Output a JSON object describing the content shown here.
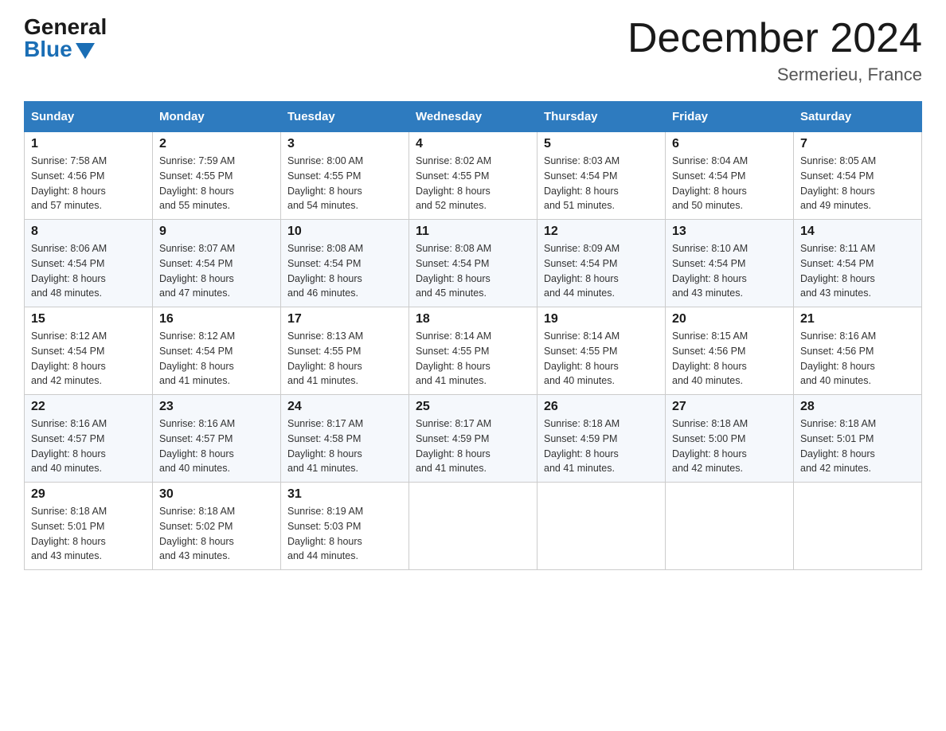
{
  "header": {
    "logo_general": "General",
    "logo_blue": "Blue",
    "month_title": "December 2024",
    "location": "Sermerieu, France"
  },
  "weekdays": [
    "Sunday",
    "Monday",
    "Tuesday",
    "Wednesday",
    "Thursday",
    "Friday",
    "Saturday"
  ],
  "weeks": [
    [
      {
        "day": "1",
        "sunrise": "7:58 AM",
        "sunset": "4:56 PM",
        "daylight": "8 hours and 57 minutes."
      },
      {
        "day": "2",
        "sunrise": "7:59 AM",
        "sunset": "4:55 PM",
        "daylight": "8 hours and 55 minutes."
      },
      {
        "day": "3",
        "sunrise": "8:00 AM",
        "sunset": "4:55 PM",
        "daylight": "8 hours and 54 minutes."
      },
      {
        "day": "4",
        "sunrise": "8:02 AM",
        "sunset": "4:55 PM",
        "daylight": "8 hours and 52 minutes."
      },
      {
        "day": "5",
        "sunrise": "8:03 AM",
        "sunset": "4:54 PM",
        "daylight": "8 hours and 51 minutes."
      },
      {
        "day": "6",
        "sunrise": "8:04 AM",
        "sunset": "4:54 PM",
        "daylight": "8 hours and 50 minutes."
      },
      {
        "day": "7",
        "sunrise": "8:05 AM",
        "sunset": "4:54 PM",
        "daylight": "8 hours and 49 minutes."
      }
    ],
    [
      {
        "day": "8",
        "sunrise": "8:06 AM",
        "sunset": "4:54 PM",
        "daylight": "8 hours and 48 minutes."
      },
      {
        "day": "9",
        "sunrise": "8:07 AM",
        "sunset": "4:54 PM",
        "daylight": "8 hours and 47 minutes."
      },
      {
        "day": "10",
        "sunrise": "8:08 AM",
        "sunset": "4:54 PM",
        "daylight": "8 hours and 46 minutes."
      },
      {
        "day": "11",
        "sunrise": "8:08 AM",
        "sunset": "4:54 PM",
        "daylight": "8 hours and 45 minutes."
      },
      {
        "day": "12",
        "sunrise": "8:09 AM",
        "sunset": "4:54 PM",
        "daylight": "8 hours and 44 minutes."
      },
      {
        "day": "13",
        "sunrise": "8:10 AM",
        "sunset": "4:54 PM",
        "daylight": "8 hours and 43 minutes."
      },
      {
        "day": "14",
        "sunrise": "8:11 AM",
        "sunset": "4:54 PM",
        "daylight": "8 hours and 43 minutes."
      }
    ],
    [
      {
        "day": "15",
        "sunrise": "8:12 AM",
        "sunset": "4:54 PM",
        "daylight": "8 hours and 42 minutes."
      },
      {
        "day": "16",
        "sunrise": "8:12 AM",
        "sunset": "4:54 PM",
        "daylight": "8 hours and 41 minutes."
      },
      {
        "day": "17",
        "sunrise": "8:13 AM",
        "sunset": "4:55 PM",
        "daylight": "8 hours and 41 minutes."
      },
      {
        "day": "18",
        "sunrise": "8:14 AM",
        "sunset": "4:55 PM",
        "daylight": "8 hours and 41 minutes."
      },
      {
        "day": "19",
        "sunrise": "8:14 AM",
        "sunset": "4:55 PM",
        "daylight": "8 hours and 40 minutes."
      },
      {
        "day": "20",
        "sunrise": "8:15 AM",
        "sunset": "4:56 PM",
        "daylight": "8 hours and 40 minutes."
      },
      {
        "day": "21",
        "sunrise": "8:16 AM",
        "sunset": "4:56 PM",
        "daylight": "8 hours and 40 minutes."
      }
    ],
    [
      {
        "day": "22",
        "sunrise": "8:16 AM",
        "sunset": "4:57 PM",
        "daylight": "8 hours and 40 minutes."
      },
      {
        "day": "23",
        "sunrise": "8:16 AM",
        "sunset": "4:57 PM",
        "daylight": "8 hours and 40 minutes."
      },
      {
        "day": "24",
        "sunrise": "8:17 AM",
        "sunset": "4:58 PM",
        "daylight": "8 hours and 41 minutes."
      },
      {
        "day": "25",
        "sunrise": "8:17 AM",
        "sunset": "4:59 PM",
        "daylight": "8 hours and 41 minutes."
      },
      {
        "day": "26",
        "sunrise": "8:18 AM",
        "sunset": "4:59 PM",
        "daylight": "8 hours and 41 minutes."
      },
      {
        "day": "27",
        "sunrise": "8:18 AM",
        "sunset": "5:00 PM",
        "daylight": "8 hours and 42 minutes."
      },
      {
        "day": "28",
        "sunrise": "8:18 AM",
        "sunset": "5:01 PM",
        "daylight": "8 hours and 42 minutes."
      }
    ],
    [
      {
        "day": "29",
        "sunrise": "8:18 AM",
        "sunset": "5:01 PM",
        "daylight": "8 hours and 43 minutes."
      },
      {
        "day": "30",
        "sunrise": "8:18 AM",
        "sunset": "5:02 PM",
        "daylight": "8 hours and 43 minutes."
      },
      {
        "day": "31",
        "sunrise": "8:19 AM",
        "sunset": "5:03 PM",
        "daylight": "8 hours and 44 minutes."
      },
      null,
      null,
      null,
      null
    ]
  ],
  "labels": {
    "sunrise": "Sunrise:",
    "sunset": "Sunset:",
    "daylight": "Daylight:"
  }
}
